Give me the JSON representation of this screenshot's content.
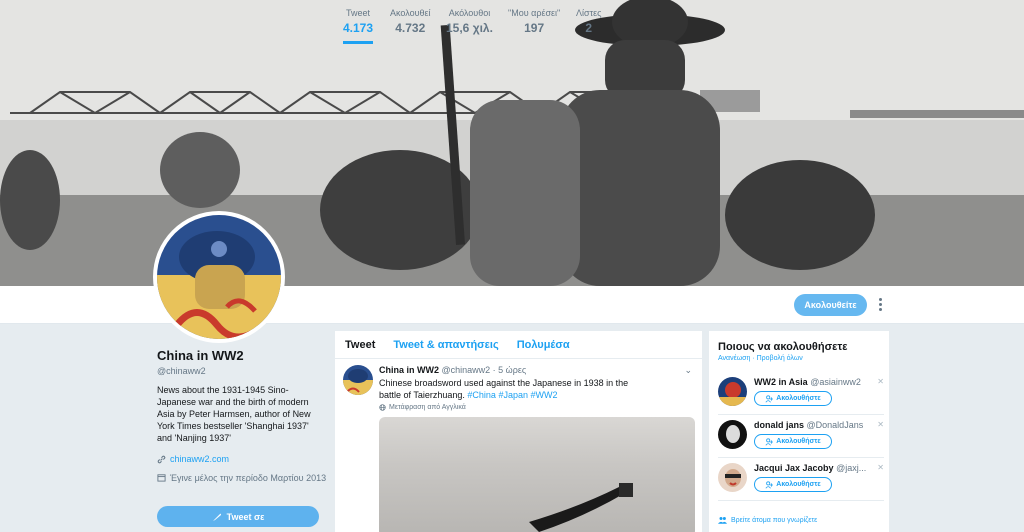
{
  "header": {
    "follow_button": "Ακολουθείτε"
  },
  "stats": [
    {
      "label": "Tweet",
      "value": "4.173"
    },
    {
      "label": "Ακολουθεί",
      "value": "4.732"
    },
    {
      "label": "Ακόλουθοι",
      "value": "15,6 χιλ."
    },
    {
      "label": "\"Μου αρέσει\"",
      "value": "197"
    },
    {
      "label": "Λίστες",
      "value": "2"
    }
  ],
  "profile": {
    "name": "China in WW2",
    "handle": "@chinaww2",
    "bio": "News about the 1931-1945 Sino-Japanese war and the birth of modern Asia by Peter Harmsen, author of New York Times bestseller 'Shanghai 1937' and 'Nanjing 1937'",
    "url": "chinaww2.com",
    "joined": "Έγινε μέλος την περίοδο Μαρτίου 2013",
    "tweet_to": "Tweet σε"
  },
  "timeline": {
    "tabs": [
      "Tweet",
      "Tweet & απαντήσεις",
      "Πολυμέσα"
    ],
    "tweet": {
      "name": "China in WW2",
      "handle": "@chinaww2",
      "time": "5 ώρες",
      "text": "Chinese broadsword used against the Japanese in 1938 in the battle of Taierzhuang.",
      "hashtags": "#China #Japan #WW2",
      "translate": "Μετάφραση από Αγγλικά"
    }
  },
  "who_to_follow": {
    "title": "Ποιους να ακολουθήσετε",
    "subtitle": "Ανανέωση · Προβολή όλων",
    "follow_label": "Ακολουθήστε",
    "find_people": "Βρείτε άτομα που γνωρίζετε",
    "suggestions": [
      {
        "name": "WW2 in Asia",
        "handle": "@asiainww2"
      },
      {
        "name": "donald jans",
        "handle": "@DonaldJans"
      },
      {
        "name": "Jacqui Jax Jacoby",
        "handle": "@jaxj..."
      }
    ]
  },
  "icons": {
    "link": "link-icon",
    "calendar": "calendar-icon",
    "quill": "quill-icon",
    "globe": "globe-icon",
    "add_user": "add-user-icon",
    "people": "people-icon",
    "chevron": "chevron-down-icon",
    "more": "more-vertical-icon",
    "close": "close-icon"
  },
  "colors": {
    "accent": "#1da1f2",
    "background": "#e6ecf0",
    "muted": "#657786"
  }
}
